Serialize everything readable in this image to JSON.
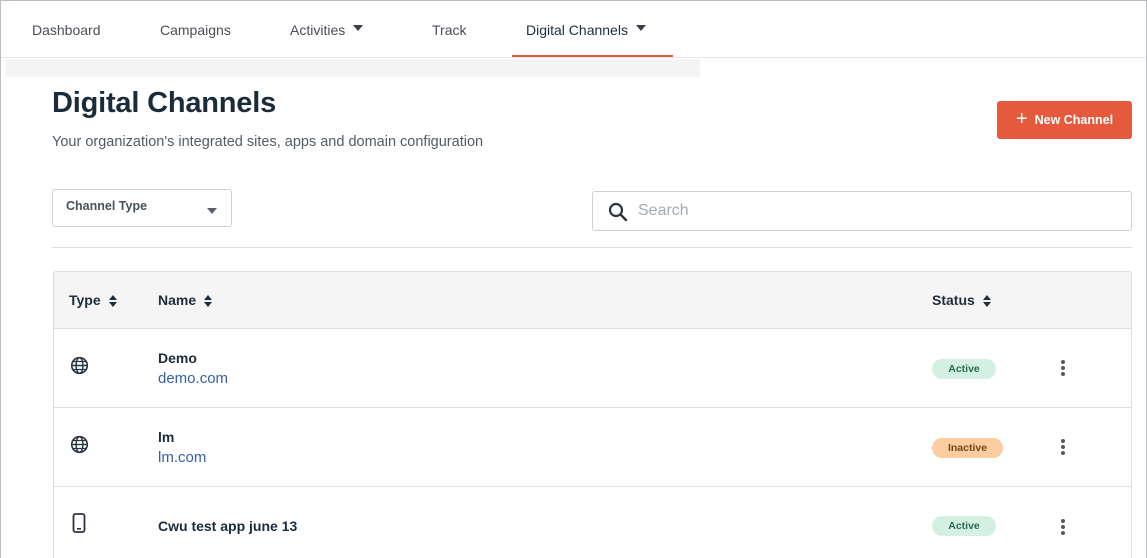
{
  "nav": {
    "items": [
      {
        "label": "Dashboard",
        "dropdown": false
      },
      {
        "label": "Campaigns",
        "dropdown": false
      },
      {
        "label": "Activities",
        "dropdown": true
      },
      {
        "label": "Track",
        "dropdown": false
      },
      {
        "label": "Digital Channels",
        "dropdown": true,
        "active": true
      }
    ],
    "active_color": "#e15a40"
  },
  "header": {
    "title": "Digital Channels",
    "subtitle": "Your organization's integrated sites, apps and domain configuration",
    "new_button_label": "New Channel",
    "new_button_icon": "plus-icon",
    "new_button_color": "#e55a3c"
  },
  "filters": {
    "channel_type_label": "Channel Type",
    "search_placeholder": "Search",
    "search_value": ""
  },
  "table": {
    "columns": {
      "type": "Type",
      "name": "Name",
      "status": "Status"
    },
    "rows": [
      {
        "type_icon": "globe-icon",
        "name": "Demo",
        "domain": "demo.com",
        "status": "Active"
      },
      {
        "type_icon": "globe-icon",
        "name": "lm",
        "domain": "lm.com",
        "status": "Inactive"
      },
      {
        "type_icon": "mobile-icon",
        "name": "Cwu test app june 13",
        "domain": "",
        "status": "Active"
      }
    ]
  },
  "colors": {
    "status_active_bg": "#d3f0e3",
    "status_inactive_bg": "#fbcd9f",
    "link": "#3560a8"
  }
}
